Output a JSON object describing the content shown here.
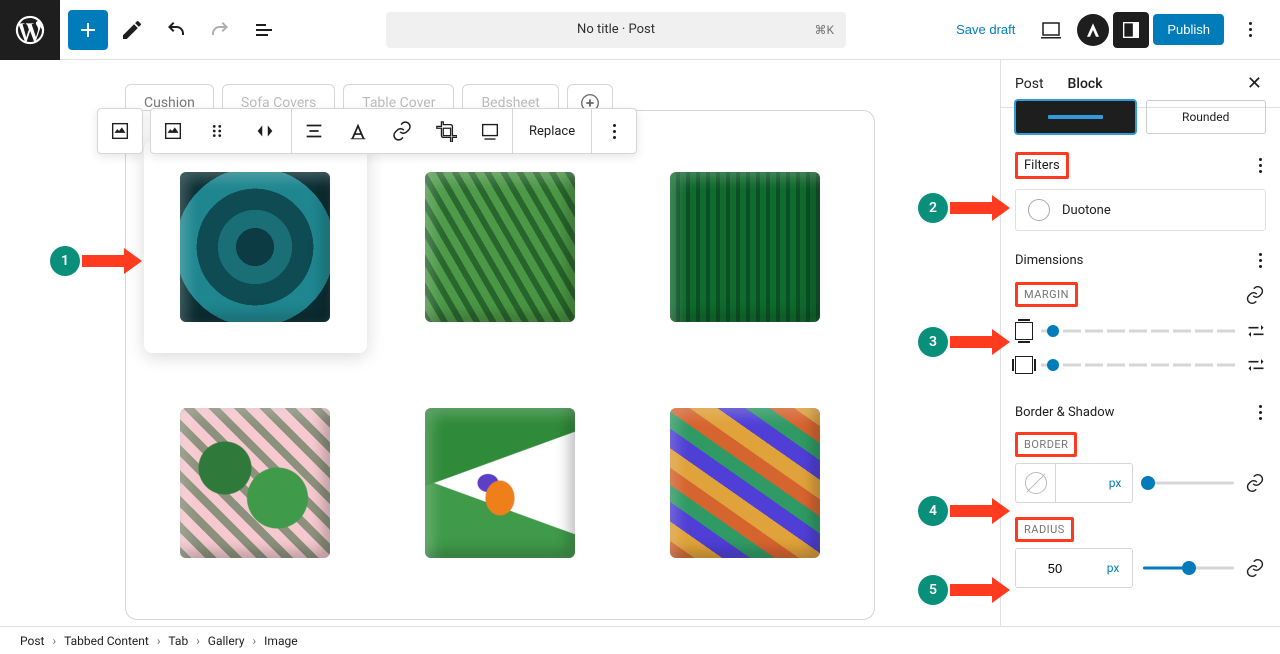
{
  "topbar": {
    "doc_title": "No title · Post",
    "kbd": "⌘K",
    "save_draft": "Save draft",
    "publish": "Publish"
  },
  "float_toolbar": {
    "replace": "Replace"
  },
  "tabs": [
    "Cushion",
    "Sofa Covers",
    "Table Cover",
    "Bedsheet"
  ],
  "sidebar": {
    "tab_post": "Post",
    "tab_block": "Block",
    "style_rounded": "Rounded",
    "panel_filters": "Filters",
    "duotone": "Duotone",
    "panel_dimensions": "Dimensions",
    "margin_label": "MARGIN",
    "panel_border": "Border & Shadow",
    "border_label": "BORDER",
    "border_unit": "px",
    "radius_label": "RADIUS",
    "radius_value": "50",
    "radius_unit": "px"
  },
  "breadcrumb": [
    "Post",
    "Tabbed Content",
    "Tab",
    "Gallery",
    "Image"
  ],
  "annotations": {
    "b1": "1",
    "b2": "2",
    "b3": "3",
    "b4": "4",
    "b5": "5"
  },
  "chart_data": null
}
